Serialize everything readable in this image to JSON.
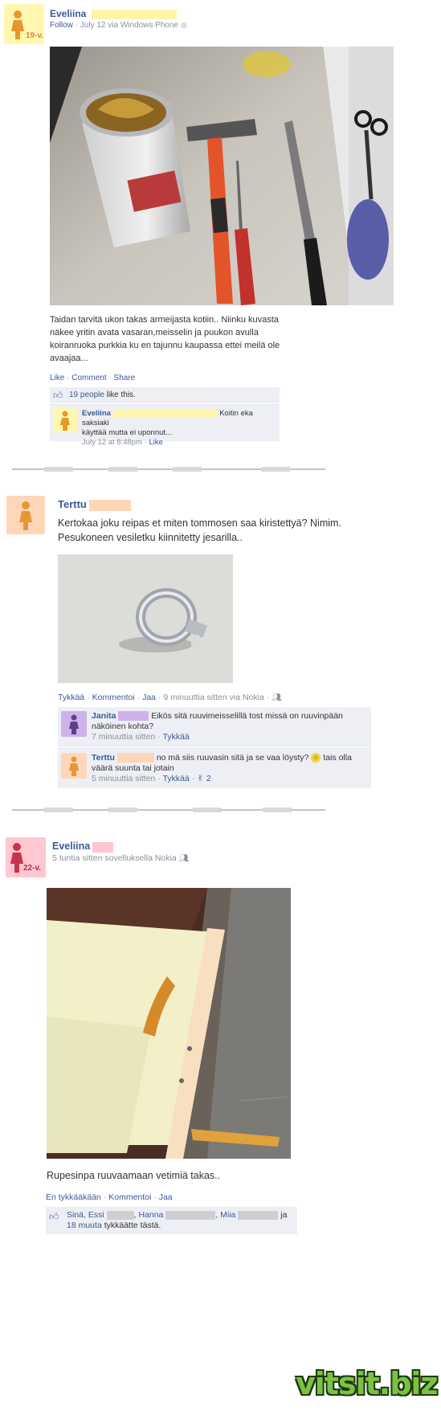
{
  "post1": {
    "author": "Eveliina",
    "age_badge": "19-v.",
    "meta_follow": "Follow",
    "meta_date": "· July 12 via Windows Phone",
    "text": "Taidan tarvitä ukon takas armeijasta kotiin.. Niinku kuvasta näkee yritin avata vasaran,meisselin ja puukon avulla koiranruoka purkkia ku en tajunnu kaupassa ettei meilä ole avaajaa...",
    "actions": {
      "like": "Like",
      "comment": "Comment",
      "share": "Share",
      "sep": "·"
    },
    "likes_count": "19 people",
    "likes_suffix": " like this.",
    "comment": {
      "author": "Eveliina",
      "text_a": "Koitin eka saksiaki",
      "text_b": "käyttää mutta ei uponnut...",
      "time": "July 12 at 8:48pm",
      "like": "Like"
    }
  },
  "post2": {
    "author": "Terttu",
    "text": "Kertokaa joku reipas et miten tommosen saa kiristettyä? Nimim. Pesukoneen vesiletku kiinnitetty jesarilla..",
    "actions": {
      "like": "Tykkää",
      "comment": "Kommentoi",
      "share": "Jaa",
      "meta": "· 9 minuuttia sitten via Nokia ·"
    },
    "comments": [
      {
        "author": "Janita",
        "text": "Eikös sitä ruuvimeisselillä tost missä on ruuvinpään näköinen kohta?",
        "time": "7 minuuttia sitten",
        "like": "Tykkää"
      },
      {
        "author": "Terttu",
        "text": "no mä siis ruuvasin sitä ja se vaa löysty?",
        "text2": "tais olla väärä suunta tai jotain",
        "time": "5 minuuttia sitten",
        "like": "Tykkää",
        "likes": "2"
      }
    ]
  },
  "post3": {
    "author": "Eveliina",
    "age_badge": "22-v.",
    "meta": "5 tuntia sitten sovelluksella Nokia",
    "text": "Rupesinpa ruuvaamaan vetimiä takas..",
    "actions": {
      "like": "En tykkääkään",
      "comment": "Kommentoi",
      "share": "Jaa"
    },
    "likes": {
      "prefix": "Sinä, Essi",
      "n2": ", Hanna",
      "n3": ", Miia",
      "and": "ja",
      "more": "18 muuta",
      "suffix": " tykkäätte tästä."
    }
  },
  "watermark": "vitsit.biz",
  "colors": {
    "fb_blue": "#3b5998",
    "badge_yellow": "#fff5a8",
    "badge_peach": "#ffd6b8",
    "badge_purple": "#cdb3ea",
    "badge_pink": "#ffc7d0",
    "watermark_green": "#7cc242"
  }
}
